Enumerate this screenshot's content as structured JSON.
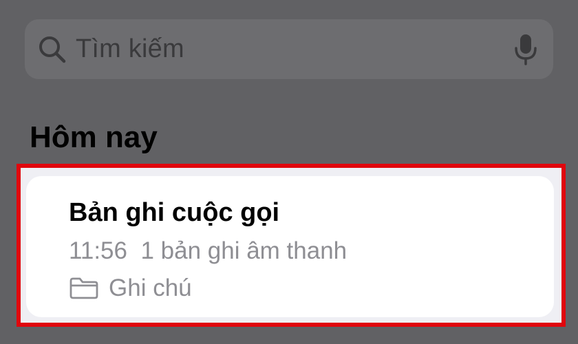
{
  "search": {
    "placeholder": "Tìm kiếm",
    "icon": "search-icon",
    "mic_icon": "microphone-icon"
  },
  "section": {
    "title": "Hôm nay"
  },
  "notes": [
    {
      "title": "Bản ghi cuộc gọi",
      "time": "11:56",
      "summary": "1 bản ghi âm thanh",
      "folder": "Ghi chú",
      "folder_icon": "folder-icon"
    }
  ],
  "colors": {
    "background": "#616164",
    "search_field": "#6d6d70",
    "card": "#ffffff",
    "highlight": "#e0060d",
    "secondary_text": "#8e8e93"
  }
}
